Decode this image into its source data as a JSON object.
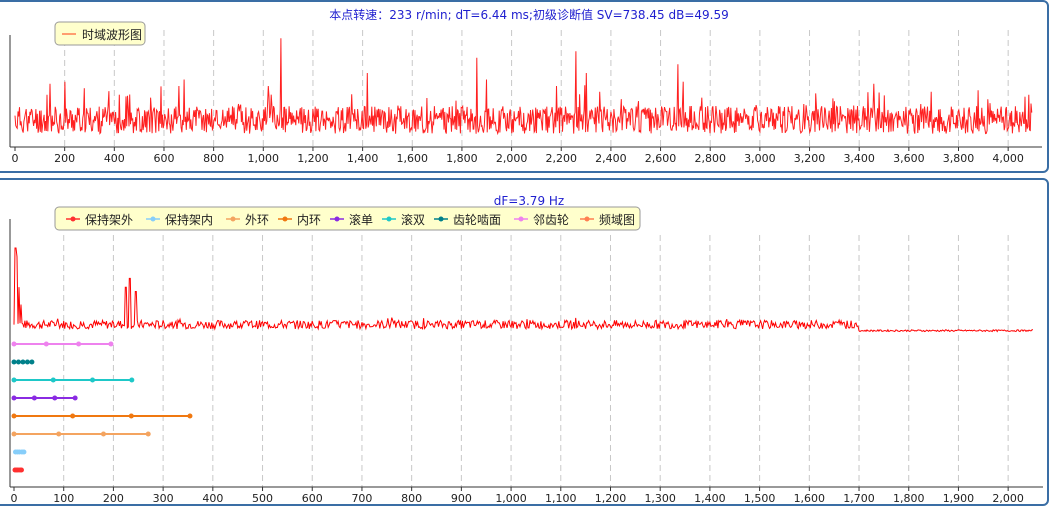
{
  "chart_data": [
    {
      "type": "line",
      "title": "本点转速：233 r/min; dT=6.44 ms;初级诊断值 SV=738.45 dB=49.59",
      "xlabel": "",
      "ylabel": "",
      "xlim": [
        0,
        4096
      ],
      "x_ticks": [
        "0",
        "200",
        "400",
        "600",
        "800",
        "1,000",
        "1,200",
        "1,400",
        "1,600",
        "1,800",
        "2,000",
        "2,200",
        "2,400",
        "2,600",
        "2,800",
        "3,000",
        "3,200",
        "3,400",
        "3,600",
        "3,800",
        "4,000"
      ],
      "grid": "vertical dashed",
      "legend_position": "top-left",
      "series": [
        {
          "name": "时域波形图",
          "color": "#ff2020",
          "baseline": 0.42,
          "noise": 0.32,
          "seed": 11,
          "peaks": [
            {
              "x": 130,
              "y": 1.0
            },
            {
              "x": 140,
              "y": 1.25
            },
            {
              "x": 200,
              "y": 1.3
            },
            {
              "x": 280,
              "y": 1.15
            },
            {
              "x": 420,
              "y": 1.0
            },
            {
              "x": 660,
              "y": 1.2
            },
            {
              "x": 680,
              "y": 1.35
            },
            {
              "x": 1070,
              "y": 2.3
            },
            {
              "x": 1020,
              "y": 1.2
            },
            {
              "x": 1420,
              "y": 1.5
            },
            {
              "x": 1860,
              "y": 1.85
            },
            {
              "x": 1900,
              "y": 1.35
            },
            {
              "x": 2180,
              "y": 1.2
            },
            {
              "x": 2260,
              "y": 2.0
            },
            {
              "x": 2300,
              "y": 1.5
            },
            {
              "x": 2670,
              "y": 1.7
            },
            {
              "x": 2690,
              "y": 1.3
            },
            {
              "x": 3460,
              "y": 1.25
            },
            {
              "x": 3480,
              "y": 1.05
            },
            {
              "x": 3880,
              "y": 1.1
            }
          ]
        }
      ]
    },
    {
      "type": "line",
      "title": "dF=3.79 Hz",
      "xlabel": "",
      "ylabel": "",
      "xlim": [
        0,
        2050
      ],
      "x_ticks": [
        "0",
        "100",
        "200",
        "300",
        "400",
        "500",
        "600",
        "700",
        "800",
        "900",
        "1,000",
        "1,100",
        "1,200",
        "1,300",
        "1,400",
        "1,500",
        "1,600",
        "1,700",
        "1,800",
        "1,900",
        "2,000"
      ],
      "grid": "vertical dashed",
      "legend_position": "top-left",
      "series": [
        {
          "name": "保持架外",
          "color": "#ff3030",
          "points": [
            2,
            5,
            8,
            12,
            15
          ]
        },
        {
          "name": "保持架内",
          "color": "#87cefa",
          "points": [
            3,
            7,
            11,
            16,
            20
          ]
        },
        {
          "name": "外环",
          "color": "#f4a460",
          "points": [
            0,
            90,
            180,
            270
          ]
        },
        {
          "name": "内环",
          "color": "#f07810",
          "points": [
            0,
            118,
            236,
            354
          ]
        },
        {
          "name": "滚单",
          "color": "#8a2be2",
          "points": [
            0,
            41,
            82,
            123
          ]
        },
        {
          "name": "滚双",
          "color": "#1ec8c8",
          "points": [
            0,
            79,
            158,
            237
          ]
        },
        {
          "name": "齿轮啮面",
          "color": "#00808a",
          "points": [
            0,
            9,
            18,
            27,
            36
          ]
        },
        {
          "name": "邻齿轮",
          "color": "#ee82ee",
          "points": [
            0,
            65,
            130,
            195
          ]
        },
        {
          "name": "频域图",
          "color": "#ff7f50",
          "spectrum": {
            "color": "#ff0000",
            "peaks": [
              {
                "x": 3,
                "y": 1.0
              },
              {
                "x": 6,
                "y": 0.9
              },
              {
                "x": 10,
                "y": 0.55
              },
              {
                "x": 14,
                "y": 0.35
              },
              {
                "x": 225,
                "y": 0.55
              },
              {
                "x": 233,
                "y": 0.65
              },
              {
                "x": 245,
                "y": 0.5
              },
              {
                "x": 760,
                "y": 0.2
              },
              {
                "x": 1020,
                "y": 0.13
              }
            ],
            "floor_start": 0.12,
            "floor_end": 0.05,
            "taper_x": 1700
          }
        }
      ]
    }
  ]
}
